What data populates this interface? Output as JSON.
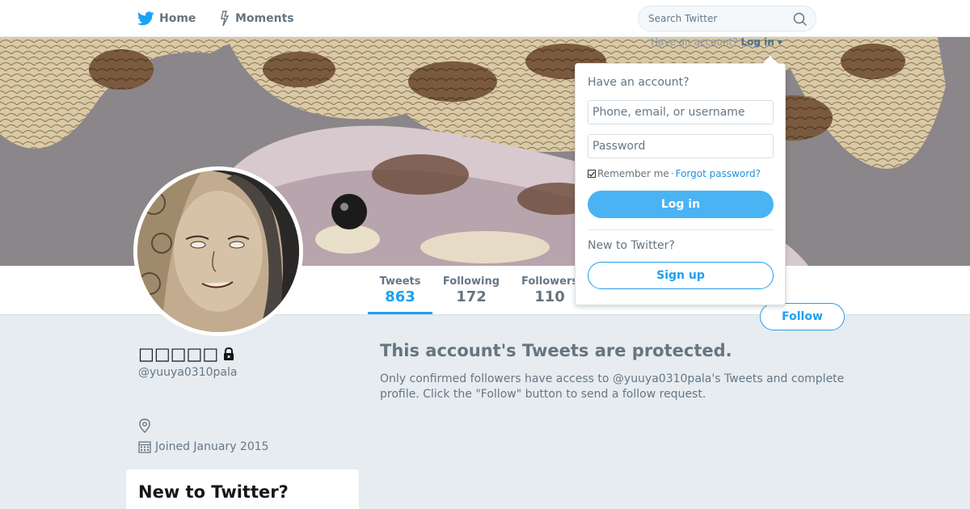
{
  "nav": {
    "home_label": "Home",
    "moments_label": "Moments",
    "search_placeholder": "Search Twitter",
    "login_hint": "Have an account?",
    "login_link": "Log in",
    "login_caret": "▾"
  },
  "profile": {
    "name": "□□□□□",
    "screen_name": "@yuuya0310pala",
    "joined": "Joined January 2015",
    "follow_label": "Follow",
    "stats": {
      "tweets_label": "Tweets",
      "tweets_value": "863",
      "following_label": "Following",
      "following_value": "172",
      "followers_label": "Followers",
      "followers_value": "110"
    }
  },
  "main": {
    "protected_title": "This account's Tweets are protected.",
    "protected_desc": "Only confirmed followers have access to @yuuya0310pala's Tweets and complete profile. Click the \"Follow\" button to send a follow request."
  },
  "sidebar": {
    "new_card_title": "New to Twitter?"
  },
  "dropdown": {
    "heading": "Have an account?",
    "username_placeholder": "Phone, email, or username",
    "password_placeholder": "Password",
    "remember_label": "Remember me",
    "separator": " · ",
    "forgot_label": "Forgot password?",
    "login_button": "Log in",
    "new_heading": "New to Twitter?",
    "signup_button": "Sign up"
  },
  "colors": {
    "accent": "#1da1f2",
    "login_button_bg": "#4ab3f4",
    "background": "#e6ecf0"
  }
}
